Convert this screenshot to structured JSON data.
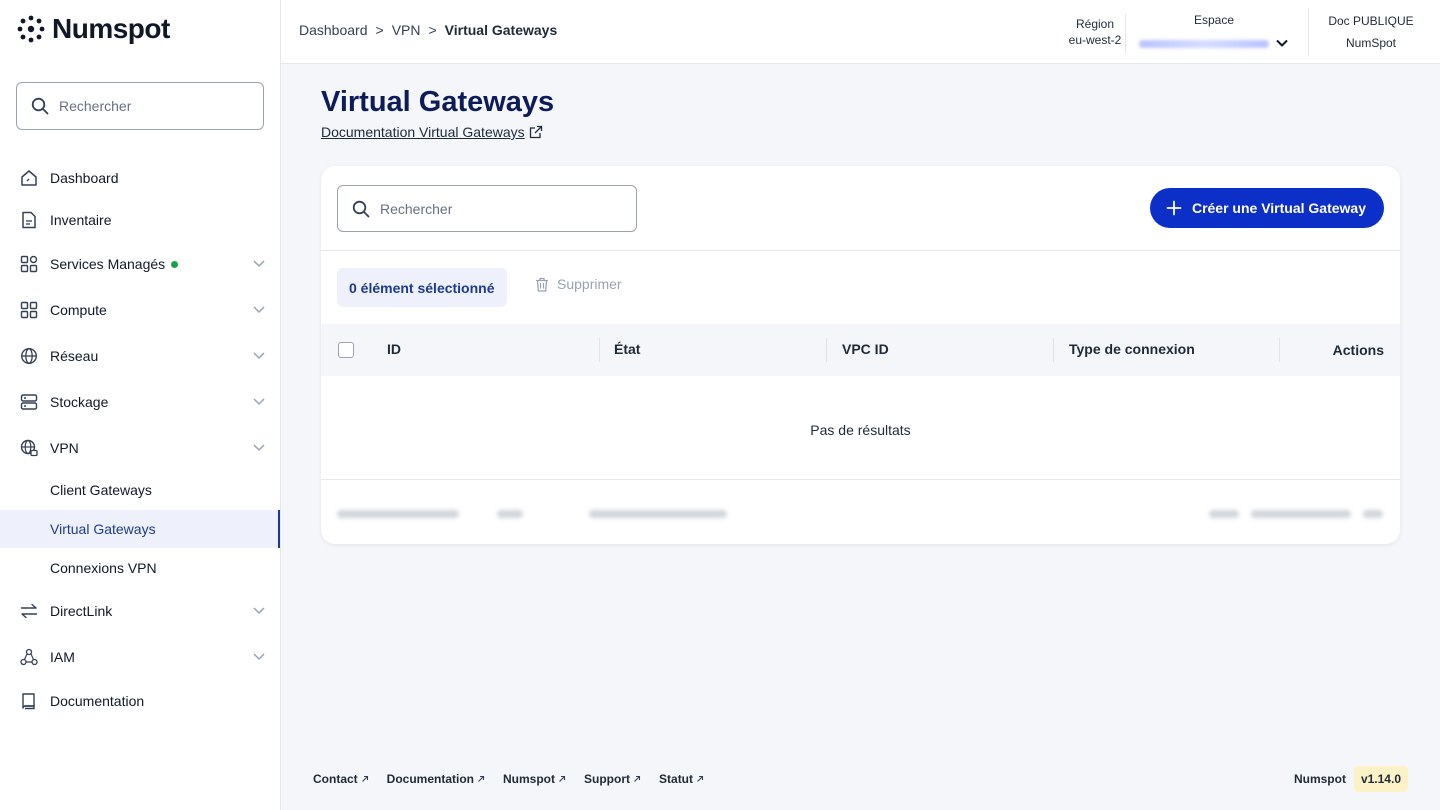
{
  "brand": {
    "name": "Numspot"
  },
  "sidebar": {
    "search_placeholder": "Rechercher",
    "items": [
      {
        "label": "Dashboard"
      },
      {
        "label": "Inventaire"
      },
      {
        "label": "Services Managés"
      },
      {
        "label": "Compute"
      },
      {
        "label": "Réseau"
      },
      {
        "label": "Stockage"
      },
      {
        "label": "VPN"
      },
      {
        "label": "DirectLink"
      },
      {
        "label": "IAM"
      },
      {
        "label": "Documentation"
      }
    ],
    "vpn_sub": [
      {
        "label": "Client Gateways"
      },
      {
        "label": "Virtual Gateways"
      },
      {
        "label": "Connexions VPN"
      }
    ]
  },
  "topbar": {
    "breadcrumb": [
      "Dashboard",
      ">",
      "VPN",
      ">",
      "Virtual Gateways"
    ],
    "region_label": "Région",
    "region_value": "eu-west-2",
    "space_label": "Espace",
    "doc_label": "Doc PUBLIQUE",
    "doc_value": "NumSpot"
  },
  "page": {
    "title": "Virtual Gateways",
    "doc_link": "Documentation Virtual Gateways"
  },
  "table": {
    "search_placeholder": "Rechercher",
    "create_label": "Créer une Virtual Gateway",
    "selection_label": "0 élément sélectionné",
    "delete_label": "Supprimer",
    "columns": [
      "ID",
      "État",
      "VPC ID",
      "Type de connexion",
      "Actions"
    ],
    "empty_text": "Pas de résultats"
  },
  "footer": {
    "links": [
      "Contact",
      "Documentation",
      "Numspot",
      "Support",
      "Statut"
    ],
    "brand": "Numspot",
    "version": "v1.14.0"
  },
  "colors": {
    "primary": "#0b2fc7",
    "title": "#0e1b59",
    "active_bg": "#eef1fb",
    "status_dot": "#16a34a"
  }
}
